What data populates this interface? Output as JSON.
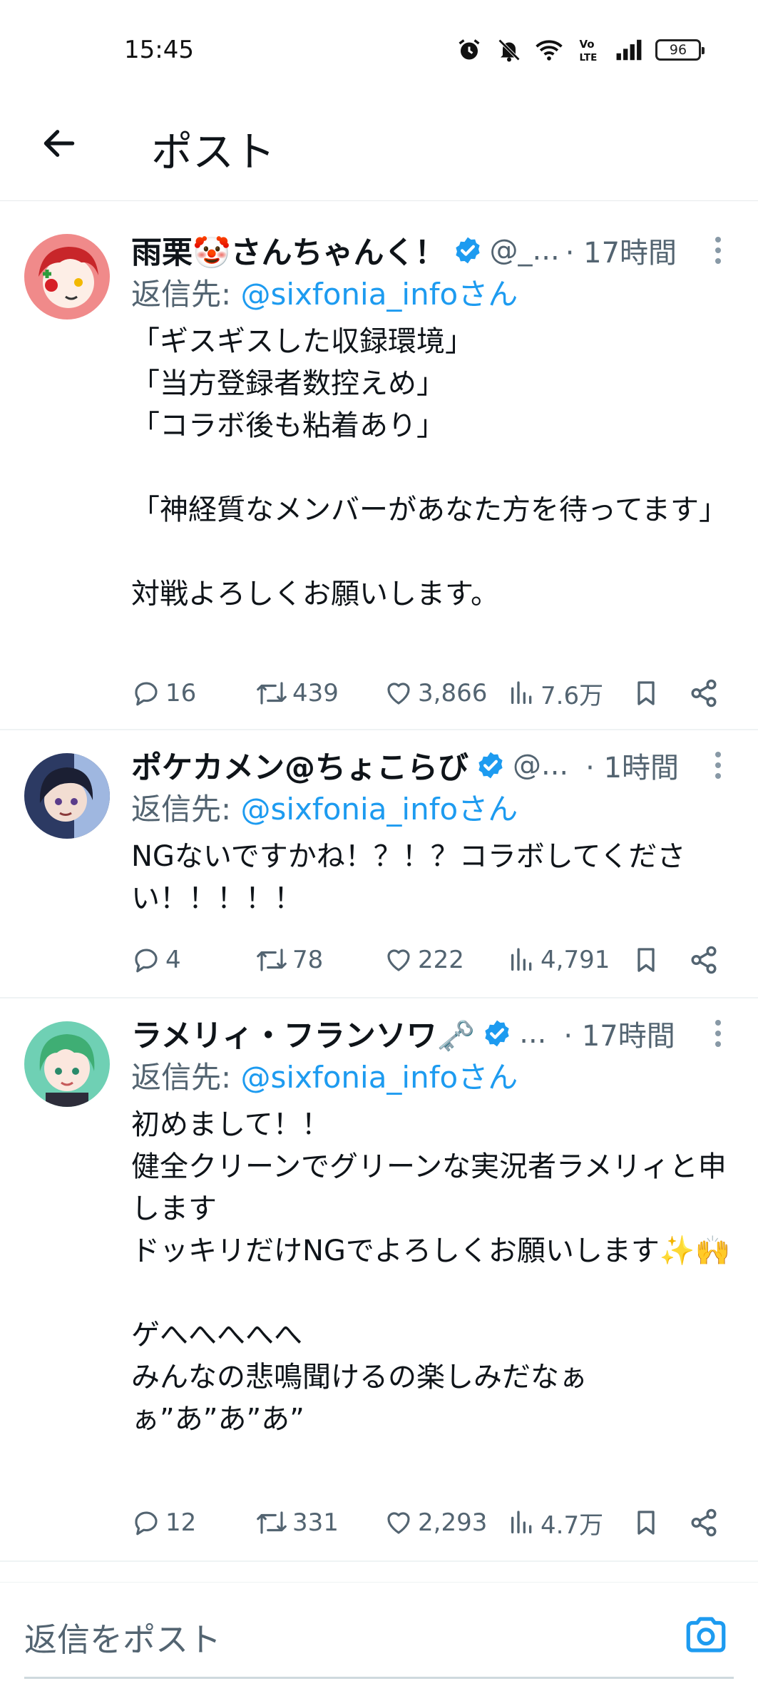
{
  "status_bar": {
    "time": "15:45",
    "battery": "96"
  },
  "header": {
    "title": "ポスト"
  },
  "tweets": [
    {
      "name": "雨栗🤡さんちゃんく！",
      "handle": "@_...",
      "time": "· 17時間",
      "reply_prefix": "返信先: ",
      "reply_to": "@sixfonia_infoさん",
      "text": "「ギスギスした収録環境」\n「当方登録者数控えめ」\n「コラボ後も粘着あり」\n\n「神経質なメンバーがあなた方を待ってます」\n\n対戦よろしくお願いします。",
      "replies": "16",
      "retweets": "439",
      "likes": "3,866",
      "views": "7.6万"
    },
    {
      "name": "ポケカメン@ちょこらび",
      "handle": "@...",
      "time": "· 1時間",
      "reply_prefix": "返信先: ",
      "reply_to": "@sixfonia_infoさん",
      "text": "NGないですかね！？！？コラボしてください！！！！！",
      "replies": "4",
      "retweets": "78",
      "likes": "222",
      "views": "4,791"
    },
    {
      "name": "ラメリィ・フランソワ🗝️",
      "handle": "...",
      "time": "· 17時間",
      "reply_prefix": "返信先: ",
      "reply_to": "@sixfonia_infoさん",
      "text": "初めまして！！\n健全クリーンでグリーンな実況者ラメリィと申します\nドッキリだけNGでよろしくお願いします✨🙌\n\nゲへへへへへ\nみんなの悲鳴聞けるの楽しみだなぁぁ”あ”あ”あ”",
      "replies": "12",
      "retweets": "331",
      "likes": "2,293",
      "views": "4.7万"
    }
  ],
  "reply_bar": {
    "placeholder": "返信をポスト"
  },
  "colors": {
    "accent": "#1d9bf0",
    "muted": "#536471",
    "text": "#0f1419"
  },
  "icons": [
    "back-arrow-icon",
    "verified-icon",
    "more-icon",
    "reply-icon",
    "retweet-icon",
    "like-icon",
    "views-icon",
    "bookmark-icon",
    "share-icon",
    "camera-icon",
    "alarm-icon",
    "mute-icon",
    "wifi-icon",
    "volte-icon",
    "signal-icon",
    "battery-icon"
  ]
}
